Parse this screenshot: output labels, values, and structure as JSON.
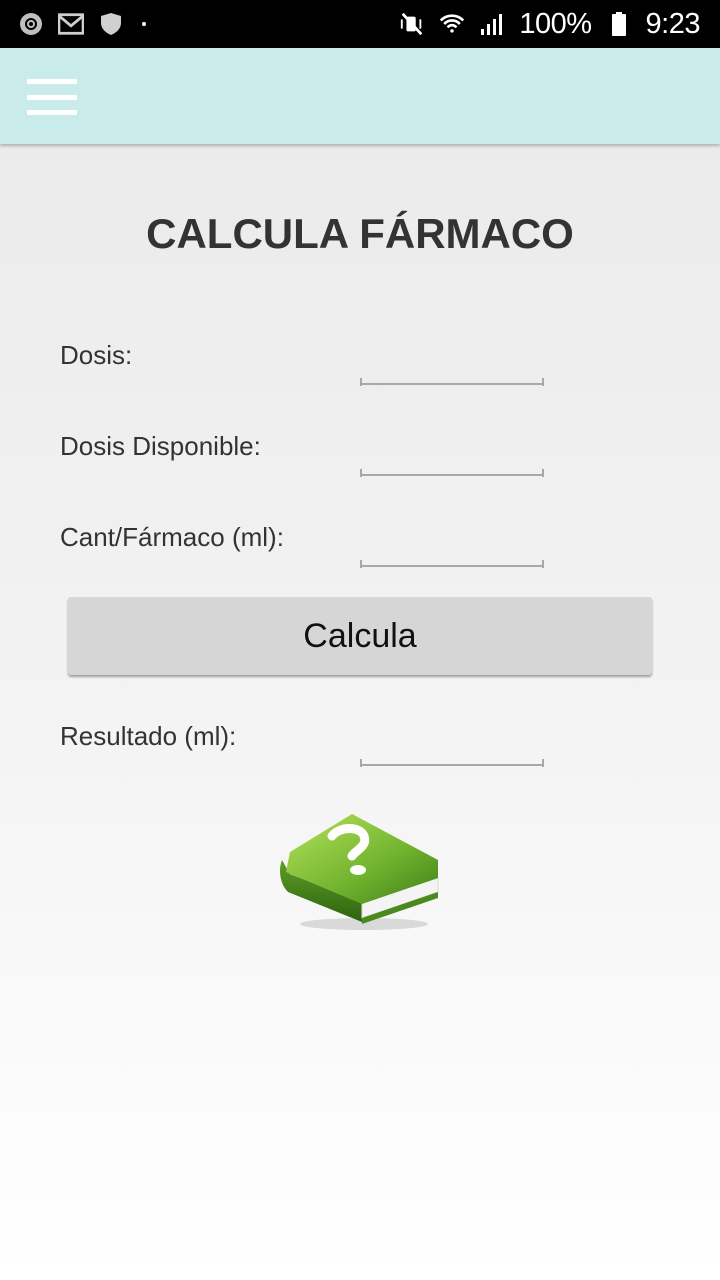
{
  "status_bar": {
    "battery": "100%",
    "time": "9:23",
    "left_icons": [
      "settings-icon",
      "gmail-icon",
      "shield-icon",
      "dot-icon"
    ],
    "right_icons": [
      "mute-vibrate-icon",
      "wifi-icon",
      "signal-icon",
      "battery-icon"
    ]
  },
  "app_bar": {
    "menu_icon": "hamburger-menu-icon",
    "background": "#c9eceb"
  },
  "main": {
    "title": "CALCULA FÁRMACO",
    "fields": {
      "dosis": {
        "label": "Dosis:",
        "value": ""
      },
      "dosis_disponible": {
        "label": "Dosis Disponible:",
        "value": ""
      },
      "cant_farmaco": {
        "label": "Cant/Fármaco (ml):",
        "value": ""
      },
      "resultado": {
        "label": "Resultado (ml):",
        "value": ""
      }
    },
    "calculate_label": "Calcula",
    "help_icon": "green-book-question-icon"
  }
}
